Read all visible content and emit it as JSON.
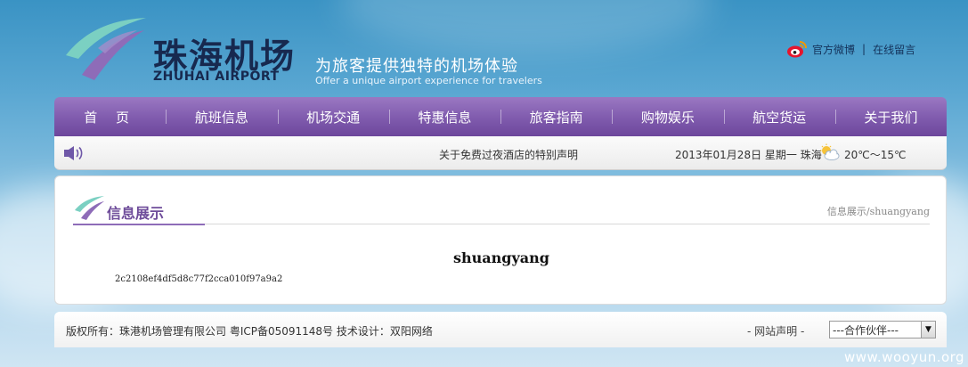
{
  "header": {
    "logo_cn": "珠海机场",
    "logo_en": "ZHUHAI AIRPORT",
    "slogan_cn": "为旅客提供独特的机场体验",
    "slogan_en": "Offer a unique airport experience for travelers",
    "links": {
      "weibo": "官方微博",
      "separator": "|",
      "message": "在线留言"
    }
  },
  "nav": {
    "items": [
      {
        "label": "首 页"
      },
      {
        "label": "航班信息"
      },
      {
        "label": "机场交通"
      },
      {
        "label": "特惠信息"
      },
      {
        "label": "旅客指南"
      },
      {
        "label": "购物娱乐"
      },
      {
        "label": "航空货运"
      },
      {
        "label": "关于我们"
      }
    ]
  },
  "infobar": {
    "notice": "关于免费过夜酒店的特别声明",
    "date": "2013年01月28日  星期一  珠海",
    "temperature": "20℃～15℃",
    "icons": [
      "speaker-icon",
      "weather-cloud-icon"
    ]
  },
  "content": {
    "section_title": "信息展示",
    "breadcrumb": "信息展示/shuangyang",
    "post_title": "shuangyang",
    "post_body": "2c2108ef4df5d8c77f2cca010f97a9a2"
  },
  "footer": {
    "copyright": "版权所有：珠港机场管理有限公司  粤ICP备05091148号  技术设计：双阳网络",
    "statement": "- 网站声明 -",
    "partner_select": "---合作伙伴---"
  },
  "watermark": "www.wooyun.org",
  "colors": {
    "nav_purple": "#7f5aad",
    "title_purple": "#6e4c9a",
    "logo_navy": "#17294f",
    "sky_blue": "#5aa7d2"
  }
}
